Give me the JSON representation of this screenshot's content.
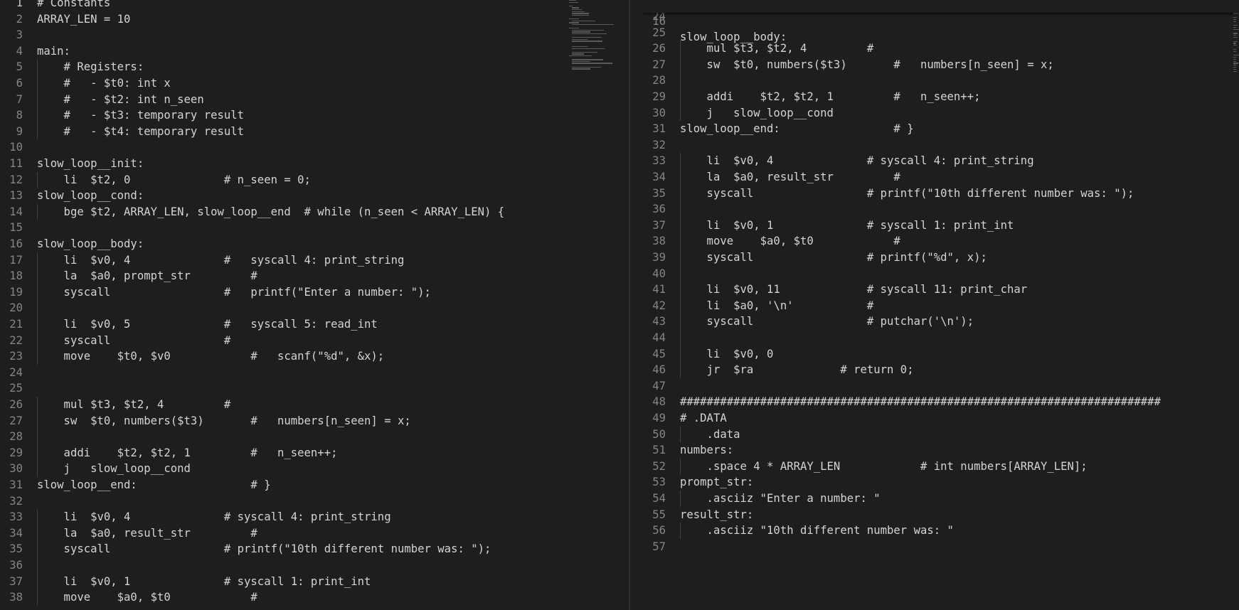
{
  "editor": {
    "left": {
      "lines": [
        {
          "n": "1",
          "t": "# Constants"
        },
        {
          "n": "2",
          "t": "ARRAY_LEN = 10"
        },
        {
          "n": "3",
          "t": ""
        },
        {
          "n": "4",
          "t": "main:"
        },
        {
          "n": "5",
          "t": "    # Registers:"
        },
        {
          "n": "6",
          "t": "    #   - $t0: int x"
        },
        {
          "n": "7",
          "t": "    #   - $t2: int n_seen"
        },
        {
          "n": "8",
          "t": "    #   - $t3: temporary result"
        },
        {
          "n": "9",
          "t": "    #   - $t4: temporary result"
        },
        {
          "n": "10",
          "t": ""
        },
        {
          "n": "11",
          "t": "slow_loop__init:"
        },
        {
          "n": "12",
          "t": "    li  $t2, 0              # n_seen = 0;"
        },
        {
          "n": "13",
          "t": "slow_loop__cond:"
        },
        {
          "n": "14",
          "t": "    bge $t2, ARRAY_LEN, slow_loop__end  # while (n_seen < ARRAY_LEN) {"
        },
        {
          "n": "15",
          "t": ""
        },
        {
          "n": "16",
          "t": "slow_loop__body:"
        },
        {
          "n": "17",
          "t": "    li  $v0, 4              #   syscall 4: print_string"
        },
        {
          "n": "18",
          "t": "    la  $a0, prompt_str         #"
        },
        {
          "n": "19",
          "t": "    syscall                 #   printf(\"Enter a number: \");"
        },
        {
          "n": "20",
          "t": ""
        },
        {
          "n": "21",
          "t": "    li  $v0, 5              #   syscall 5: read_int"
        },
        {
          "n": "22",
          "t": "    syscall                 #"
        },
        {
          "n": "23",
          "t": "    move    $t0, $v0            #   scanf(\"%d\", &x);"
        },
        {
          "n": "24",
          "t": ""
        },
        {
          "n": "25",
          "t": ""
        },
        {
          "n": "26",
          "t": "    mul $t3, $t2, 4         #"
        },
        {
          "n": "27",
          "t": "    sw  $t0, numbers($t3)       #   numbers[n_seen] = x;"
        },
        {
          "n": "28",
          "t": ""
        },
        {
          "n": "29",
          "t": "    addi    $t2, $t2, 1         #   n_seen++;"
        },
        {
          "n": "30",
          "t": "    j   slow_loop__cond"
        },
        {
          "n": "31",
          "t": "slow_loop__end:                 # }"
        },
        {
          "n": "32",
          "t": ""
        },
        {
          "n": "33",
          "t": "    li  $v0, 4              # syscall 4: print_string"
        },
        {
          "n": "34",
          "t": "    la  $a0, result_str         #"
        },
        {
          "n": "35",
          "t": "    syscall                 # printf(\"10th different number was: \");"
        },
        {
          "n": "36",
          "t": ""
        },
        {
          "n": "37",
          "t": "    li  $v0, 1              # syscall 1: print_int"
        },
        {
          "n": "38",
          "t": "    move    $a0, $t0            #"
        }
      ]
    },
    "right": {
      "sticky": {
        "n": "16",
        "t": "slow_loop__body:"
      },
      "lines": [
        {
          "n": "24",
          "t": ""
        },
        {
          "n": "25",
          "t": ""
        },
        {
          "n": "26",
          "t": "    mul $t3, $t2, 4         #"
        },
        {
          "n": "27",
          "t": "    sw  $t0, numbers($t3)       #   numbers[n_seen] = x;"
        },
        {
          "n": "28",
          "t": ""
        },
        {
          "n": "29",
          "t": "    addi    $t2, $t2, 1         #   n_seen++;"
        },
        {
          "n": "30",
          "t": "    j   slow_loop__cond"
        },
        {
          "n": "31",
          "t": "slow_loop__end:                 # }"
        },
        {
          "n": "32",
          "t": ""
        },
        {
          "n": "33",
          "t": "    li  $v0, 4              # syscall 4: print_string"
        },
        {
          "n": "34",
          "t": "    la  $a0, result_str         #"
        },
        {
          "n": "35",
          "t": "    syscall                 # printf(\"10th different number was: \");"
        },
        {
          "n": "36",
          "t": ""
        },
        {
          "n": "37",
          "t": "    li  $v0, 1              # syscall 1: print_int"
        },
        {
          "n": "38",
          "t": "    move    $a0, $t0            #"
        },
        {
          "n": "39",
          "t": "    syscall                 # printf(\"%d\", x);"
        },
        {
          "n": "40",
          "t": ""
        },
        {
          "n": "41",
          "t": "    li  $v0, 11             # syscall 11: print_char"
        },
        {
          "n": "42",
          "t": "    li  $a0, '\\n'           #"
        },
        {
          "n": "43",
          "t": "    syscall                 # putchar('\\n');"
        },
        {
          "n": "44",
          "t": ""
        },
        {
          "n": "45",
          "t": "    li  $v0, 0"
        },
        {
          "n": "46",
          "t": "    jr  $ra             # return 0;"
        },
        {
          "n": "47",
          "t": ""
        },
        {
          "n": "48",
          "t": "########################################################################"
        },
        {
          "n": "49",
          "t": "# .DATA"
        },
        {
          "n": "50",
          "t": "    .data"
        },
        {
          "n": "51",
          "t": "numbers:"
        },
        {
          "n": "52",
          "t": "    .space 4 * ARRAY_LEN            # int numbers[ARRAY_LEN];"
        },
        {
          "n": "53",
          "t": "prompt_str:"
        },
        {
          "n": "54",
          "t": "    .asciiz \"Enter a number: \""
        },
        {
          "n": "55",
          "t": "result_str:"
        },
        {
          "n": "56",
          "t": "    .asciiz \"10th different number was: \""
        },
        {
          "n": "57",
          "t": ""
        }
      ]
    },
    "active_line": "1",
    "colors": {
      "background": "#1e1e1e",
      "text": "#d4d4d4",
      "line_number": "#858585",
      "guide": "#404040"
    }
  }
}
